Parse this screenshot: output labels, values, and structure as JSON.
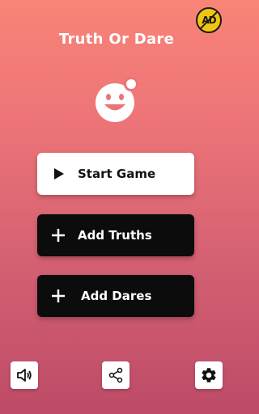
{
  "ad_badge": {
    "text": "AD",
    "icon": "no-ads-icon"
  },
  "app": {
    "title": "Truth Or Dare",
    "logo_icon": "smiley-logo-icon"
  },
  "menu": {
    "start_label": "Start Game",
    "add_truths_label": "Add Truths",
    "add_dares_label": "Add Dares"
  },
  "bottom_bar": {
    "sound_icon": "speaker-icon",
    "share_icon": "share-icon",
    "settings_icon": "gear-icon"
  },
  "colors": {
    "background_top": "#f98477",
    "background_bottom": "#bd4b67",
    "primary_button": "#ffffff",
    "secondary_button": "#0c0c0c",
    "ad_badge": "#f1c40f"
  }
}
